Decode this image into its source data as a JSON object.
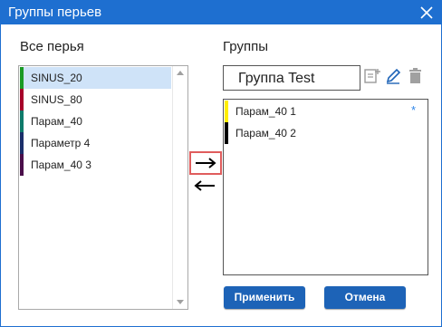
{
  "window": {
    "title": "Группы перьев",
    "title_bar_color": "#1e6fd0",
    "close_icon": "close-icon"
  },
  "left_panel": {
    "label": "Все перья",
    "items": [
      {
        "label": "SINUS_20",
        "color": "#1a9a24",
        "selected": true
      },
      {
        "label": "SINUS_80",
        "color": "#a6002a",
        "selected": false
      },
      {
        "label": "Парам_40",
        "color": "#0f7a6a",
        "selected": false
      },
      {
        "label": "Параметр 4",
        "color": "#1b2f6a",
        "selected": false
      },
      {
        "label": "Парам_40 3",
        "color": "#4a0f4a",
        "selected": false
      }
    ]
  },
  "right_panel": {
    "label": "Группы",
    "group_name_value": "Группа Test",
    "group_items": [
      {
        "label": "Парам_40 1",
        "color": "#ffee00",
        "star": "*"
      },
      {
        "label": "Парам_40 2",
        "color": "#000000",
        "star": ""
      }
    ]
  },
  "buttons": {
    "apply": "Применить",
    "cancel": "Отмена"
  }
}
